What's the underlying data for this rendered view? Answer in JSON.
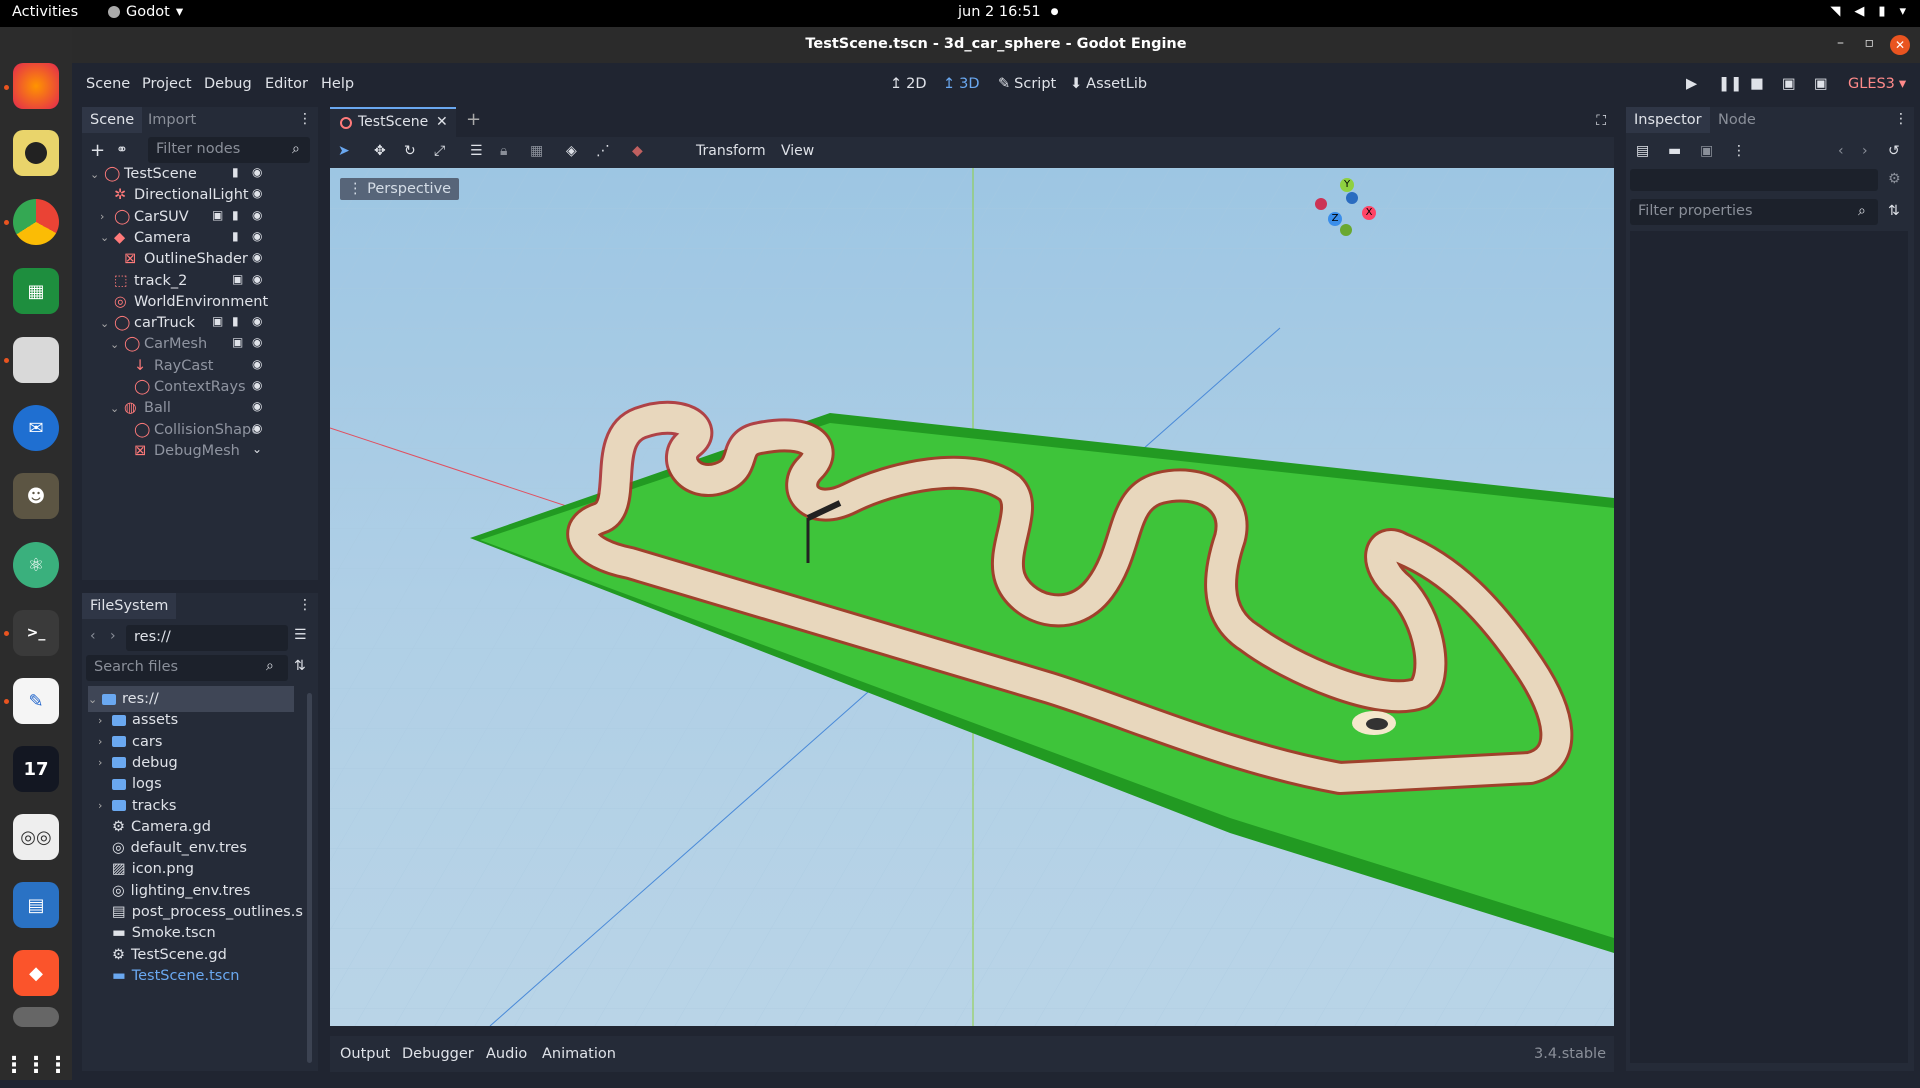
{
  "topbar": {
    "activities": "Activities",
    "app": "Godot",
    "app_caret": "▾",
    "clock": "jun 2  16:51",
    "dot": "●",
    "tray": [
      "wifi",
      "vol",
      "bat",
      "▾"
    ]
  },
  "window": {
    "title": "TestScene.tscn - 3d_car_sphere - Godot Engine",
    "minimize": "–",
    "maximize": "▫",
    "close": "✕"
  },
  "menu": [
    "Scene",
    "Project",
    "Debug",
    "Editor",
    "Help"
  ],
  "modes": [
    {
      "icon": "↥",
      "label": "2D"
    },
    {
      "icon": "↥",
      "label": "3D"
    },
    {
      "icon": "✎",
      "label": "Script"
    },
    {
      "icon": "⬇",
      "label": "AssetLib"
    }
  ],
  "renderer": "GLES3",
  "renderer_caret": "▾",
  "scene_dock": {
    "tabs": [
      "Scene",
      "Import"
    ],
    "filter_placeholder": "Filter nodes",
    "nodes": [
      {
        "label": "TestScene",
        "depth": 0,
        "arrow": "⌄",
        "icon": "node",
        "dim": false
      },
      {
        "label": "DirectionalLight",
        "depth": 1,
        "arrow": "",
        "icon": "light",
        "dim": false
      },
      {
        "label": "CarSUV",
        "depth": 1,
        "arrow": "›",
        "icon": "node",
        "dim": false
      },
      {
        "label": "Camera",
        "depth": 1,
        "arrow": "⌄",
        "icon": "camera",
        "dim": false
      },
      {
        "label": "OutlineShader",
        "depth": 2,
        "arrow": "",
        "icon": "mesh",
        "dim": false
      },
      {
        "label": "track_2",
        "depth": 1,
        "arrow": "",
        "icon": "grid",
        "dim": false
      },
      {
        "label": "WorldEnvironment",
        "depth": 1,
        "arrow": "",
        "icon": "globe",
        "dim": false
      },
      {
        "label": "carTruck",
        "depth": 1,
        "arrow": "⌄",
        "icon": "node",
        "dim": false
      },
      {
        "label": "CarMesh",
        "depth": 2,
        "arrow": "⌄",
        "icon": "node",
        "dim": true
      },
      {
        "label": "RayCast",
        "depth": 3,
        "arrow": "",
        "icon": "ray",
        "dim": true
      },
      {
        "label": "ContextRays",
        "depth": 3,
        "arrow": "",
        "icon": "node",
        "dim": true
      },
      {
        "label": "Ball",
        "depth": 2,
        "arrow": "⌄",
        "icon": "ball",
        "dim": true
      },
      {
        "label": "CollisionShape",
        "depth": 3,
        "arrow": "",
        "icon": "node",
        "dim": true
      },
      {
        "label": "DebugMesh",
        "depth": 3,
        "arrow": "",
        "icon": "mesh",
        "dim": true
      }
    ]
  },
  "filesystem": {
    "tab": "FileSystem",
    "path": "res://",
    "search_placeholder": "Search files",
    "items": [
      {
        "label": "res://",
        "depth": 0,
        "kind": "folder",
        "arrow": "⌄",
        "selected": true
      },
      {
        "label": "assets",
        "depth": 1,
        "kind": "folder",
        "arrow": "›"
      },
      {
        "label": "cars",
        "depth": 1,
        "kind": "folder",
        "arrow": "›"
      },
      {
        "label": "debug",
        "depth": 1,
        "kind": "folder",
        "arrow": "›"
      },
      {
        "label": "logs",
        "depth": 1,
        "kind": "folder",
        "arrow": ""
      },
      {
        "label": "tracks",
        "depth": 1,
        "kind": "folder",
        "arrow": "›"
      },
      {
        "label": "Camera.gd",
        "depth": 1,
        "kind": "gear",
        "arrow": ""
      },
      {
        "label": "default_env.tres",
        "depth": 1,
        "kind": "globe",
        "arrow": ""
      },
      {
        "label": "icon.png",
        "depth": 1,
        "kind": "image",
        "arrow": ""
      },
      {
        "label": "lighting_env.tres",
        "depth": 1,
        "kind": "globe",
        "arrow": ""
      },
      {
        "label": "post_process_outlines.s",
        "depth": 1,
        "kind": "file",
        "arrow": ""
      },
      {
        "label": "Smoke.tscn",
        "depth": 1,
        "kind": "scene",
        "arrow": ""
      },
      {
        "label": "TestScene.gd",
        "depth": 1,
        "kind": "gear",
        "arrow": ""
      },
      {
        "label": "TestScene.tscn",
        "depth": 1,
        "kind": "scene",
        "arrow": "",
        "highlight": true
      }
    ]
  },
  "editor": {
    "scene_tab": "TestScene",
    "tab_close": "✕",
    "add_tab": "+",
    "toolbar_menus": [
      "Transform",
      "View"
    ],
    "perspective": "Perspective",
    "gizmo": {
      "y": "Y",
      "x": "X",
      "z": "Z"
    }
  },
  "bottom": {
    "tabs": [
      "Output",
      "Debugger",
      "Audio",
      "Animation"
    ],
    "version": "3.4.stable"
  },
  "inspector": {
    "tabs": [
      "Inspector",
      "Node"
    ],
    "filter_placeholder": "Filter properties"
  },
  "colors": {
    "accent": "#6aa8f0",
    "node_red": "#ff7a7a",
    "panel": "#252b38",
    "bg": "#202531",
    "grass": "#3ec43a",
    "track": "#e8d7bd"
  }
}
